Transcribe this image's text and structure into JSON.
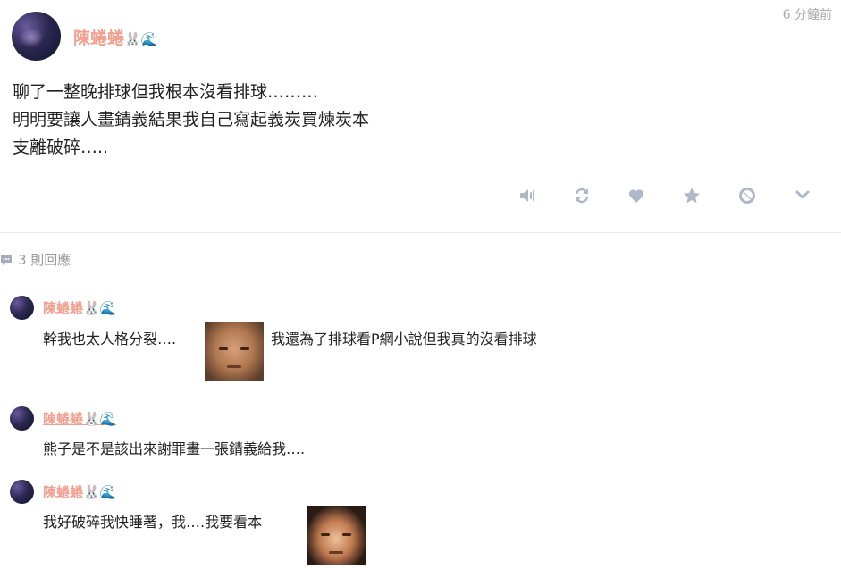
{
  "post": {
    "author": "陳蜷蜷",
    "emoji_rabbit": "🐰",
    "emoji_wave": "🌊",
    "time": "6 分鐘前",
    "lines": [
      "聊了一整晚排球但我根本沒看排球………",
      "明明要讓人畫錆義結果我自己寫起義炭買煉炭本",
      "支離破碎….."
    ],
    "actions": [
      "speaker-icon",
      "repost-icon",
      "heart-icon",
      "star-icon",
      "block-icon",
      "chevron-down-icon"
    ]
  },
  "replies": {
    "count_label": "3 則回應"
  },
  "comments": [
    {
      "author": "陳蜷蜷",
      "text_before": "幹我也太人格分裂….",
      "text_after": "我還為了排球看P網小說但我真的沒看排球"
    },
    {
      "author": "陳蜷蜷",
      "text_before": "熊子是不是該出來謝罪畫一張錆義給我….",
      "text_after": ""
    },
    {
      "author": "陳蜷蜷",
      "text_before": "我好破碎我快睡著，我….我要看本",
      "text_after": ""
    }
  ]
}
